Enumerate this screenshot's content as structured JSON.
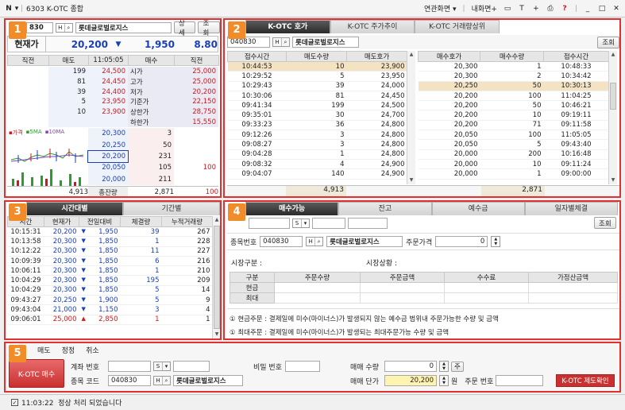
{
  "window": {
    "menu_label": "N",
    "title": "6303 K-OTC 종합",
    "link_screen": "연관화면",
    "my_screen": "내화면+"
  },
  "colors": {
    "accent": "#e0302f",
    "badge": "#f28c28",
    "up": "#d2161d",
    "down": "#1a3fb8",
    "highlight": "#f4e3c2"
  },
  "p1": {
    "badge": "1",
    "code": "830",
    "name": "롯데글로벌로지스",
    "detail": "상세",
    "query": "조회",
    "price_label": "현재가",
    "price": "20,200",
    "arrow": "▼",
    "change": "1,950",
    "rate": "8.80",
    "headers": [
      "직전",
      "매도",
      "11:05:05",
      "매수",
      "직전"
    ],
    "ask_rows": [
      {
        "qty": "199",
        "price": "24,500",
        "label": "시가",
        "value": "25,000"
      },
      {
        "qty": "81",
        "price": "24,450",
        "label": "고가",
        "value": "25,000"
      },
      {
        "qty": "39",
        "price": "24,400",
        "label": "저가",
        "value": "20,200"
      },
      {
        "qty": "5",
        "price": "23,950",
        "label": "기준가",
        "value": "22,150"
      },
      {
        "qty": "10",
        "price": "23,900",
        "label": "상한가",
        "value": "28,750"
      },
      {
        "qty": "",
        "price": "",
        "label": "하한가",
        "value": "15,550"
      }
    ],
    "legend": [
      "가격",
      "5MA",
      "10MA"
    ],
    "bid_rows": [
      {
        "price": "20,300",
        "qty": "3",
        "prev": ""
      },
      {
        "price": "20,250",
        "qty": "50",
        "prev": ""
      },
      {
        "price": "20,200",
        "qty": "231",
        "prev": ""
      },
      {
        "price": "20,050",
        "qty": "105",
        "prev": "100"
      },
      {
        "price": "20,000",
        "qty": "211",
        "prev": ""
      }
    ],
    "total": {
      "ask": "4,913",
      "label": "총잔량",
      "bid": "2,871",
      "prev": "100"
    }
  },
  "p2": {
    "badge": "2",
    "tabs": [
      "K-OTC 호가",
      "K-OTC 주가추이",
      "K-OTC 거래량상위"
    ],
    "code": "040830",
    "name": "롯데글로벌로지스",
    "query": "조회",
    "sell_headers": [
      "접수시간",
      "매도수량",
      "매도호가"
    ],
    "sell_rows": [
      [
        "10:44:53",
        "10",
        "23,900"
      ],
      [
        "10:29:52",
        "5",
        "23,950"
      ],
      [
        "10:29:43",
        "39",
        "24,000"
      ],
      [
        "10:30:06",
        "81",
        "24,450"
      ],
      [
        "09:41:34",
        "199",
        "24,500"
      ],
      [
        "09:35:01",
        "30",
        "24,700"
      ],
      [
        "09:33:23",
        "36",
        "24,800"
      ],
      [
        "09:12:26",
        "3",
        "24,800"
      ],
      [
        "09:08:27",
        "3",
        "24,800"
      ],
      [
        "09:04:28",
        "1",
        "24,800"
      ],
      [
        "09:08:32",
        "4",
        "24,900"
      ],
      [
        "09:04:07",
        "140",
        "24,900"
      ]
    ],
    "sell_total": "4,913",
    "buy_headers": [
      "매수호가",
      "매수수량",
      "접수시간"
    ],
    "buy_rows": [
      [
        "20,300",
        "1",
        "10:48:33"
      ],
      [
        "20,300",
        "2",
        "10:34:42"
      ],
      [
        "20,250",
        "50",
        "10:30:13"
      ],
      [
        "20,200",
        "100",
        "11:04:25"
      ],
      [
        "20,200",
        "50",
        "10:46:21"
      ],
      [
        "20,200",
        "10",
        "09:19:11"
      ],
      [
        "20,200",
        "71",
        "09:11:58"
      ],
      [
        "20,050",
        "100",
        "11:05:05"
      ],
      [
        "20,050",
        "5",
        "09:43:40"
      ],
      [
        "20,000",
        "200",
        "10:16:48"
      ],
      [
        "20,000",
        "10",
        "09:11:24"
      ],
      [
        "20,000",
        "1",
        "09:00:00"
      ]
    ],
    "buy_total": "2,871"
  },
  "p3": {
    "badge": "3",
    "tabs": [
      "시간대별",
      "기간별"
    ],
    "headers": [
      "시간",
      "현재가",
      "전일대비",
      "체결량",
      "누적거래량"
    ],
    "rows": [
      {
        "t": "10:15:31",
        "p": "20,200",
        "a": "▼",
        "d": "1,950",
        "v": "39",
        "c": "267"
      },
      {
        "t": "10:13:58",
        "p": "20,300",
        "a": "▼",
        "d": "1,850",
        "v": "1",
        "c": "228"
      },
      {
        "t": "10:12:22",
        "p": "20,300",
        "a": "▼",
        "d": "1,850",
        "v": "11",
        "c": "227"
      },
      {
        "t": "10:09:39",
        "p": "20,300",
        "a": "▼",
        "d": "1,850",
        "v": "6",
        "c": "216"
      },
      {
        "t": "10:06:11",
        "p": "20,300",
        "a": "▼",
        "d": "1,850",
        "v": "1",
        "c": "210"
      },
      {
        "t": "10:04:29",
        "p": "20,300",
        "a": "▼",
        "d": "1,850",
        "v": "195",
        "c": "209"
      },
      {
        "t": "10:04:29",
        "p": "20,300",
        "a": "▼",
        "d": "1,850",
        "v": "5",
        "c": "14"
      },
      {
        "t": "09:43:27",
        "p": "20,250",
        "a": "▼",
        "d": "1,900",
        "v": "5",
        "c": "9"
      },
      {
        "t": "09:43:04",
        "p": "21,000",
        "a": "▼",
        "d": "1,150",
        "v": "3",
        "c": "4"
      },
      {
        "t": "09:06:01",
        "p": "25,000",
        "a": "▲",
        "d": "2,850",
        "v": "1",
        "c": "1"
      }
    ]
  },
  "p4": {
    "badge": "4",
    "tabs": [
      "매수가능",
      "잔고",
      "예수금",
      "일자별체결"
    ],
    "query": "조회",
    "code_label": "종목번호",
    "code": "040830",
    "name": "롯데글로벌로지스",
    "price_label": "주문가격",
    "price": "0",
    "market_label": "시장구분 :",
    "status_label": "시장상황 :",
    "headers": [
      "구분",
      "주문수량",
      "주문금액",
      "수수료",
      "가정산금액"
    ],
    "rows": [
      "현금",
      "최대"
    ],
    "notes": [
      "① 현금주문 : 결제일에 미수(마이너스)가 발생되지 않는 예수금 범위내 주문가능한 수량 및 금액",
      "① 최대주문 : 결제일에 미수(마이너스)가 발생되는 최대주문가능 수량 및 금액"
    ]
  },
  "p5": {
    "badge": "5",
    "tabs": [
      "매도",
      "정정",
      "취소"
    ],
    "buy_button": "K-OTC 매수",
    "account_label": "계좌 번호",
    "password_label": "비밀 번호",
    "code_label": "종목 코드",
    "code": "040830",
    "name": "롯데글로벌로지스",
    "qty_label": "매매 수량",
    "qty": "0",
    "qty_btn": "주",
    "price_label": "매매 단가",
    "price": "20,200",
    "won": "원",
    "order_label": "주문 번호",
    "confirm_button": "K-OTC 제도확인"
  },
  "status": {
    "text": "11:03:22  정상 처리 되었습니다"
  }
}
